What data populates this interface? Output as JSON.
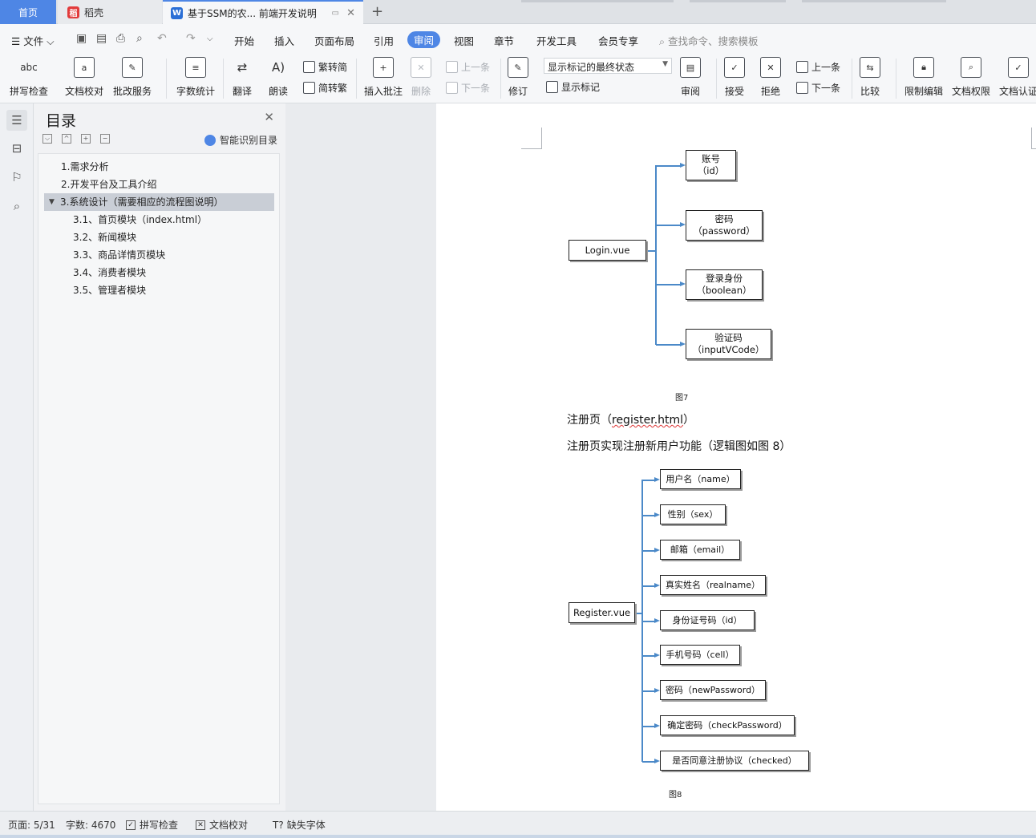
{
  "tabs": {
    "home": "首页",
    "daoke": "稻壳",
    "doc": "基于SSM的农... 前端开发说明",
    "add": "+"
  },
  "menu": {
    "file": "文件",
    "items": [
      "开始",
      "插入",
      "页面布局",
      "引用",
      "审阅",
      "视图",
      "章节",
      "开发工具",
      "会员专享"
    ],
    "active": "审阅",
    "search_placeholder": "查找命令、搜索模板"
  },
  "ribbon": {
    "spell": "拼写检查",
    "proof": "文档校对",
    "correct": "批改服务",
    "wordcount": "字数统计",
    "translate": "翻译",
    "read": "朗读",
    "trad2simp": "繁转简",
    "simp2trad": "简转繁",
    "insert_comment": "插入批注",
    "delete": "删除",
    "prev_comment": "上一条",
    "next_comment": "下一条",
    "track": "修订",
    "markup_state": "显示标记的最终状态",
    "show_markup": "显示标记",
    "review": "审阅",
    "accept": "接受",
    "reject": "拒绝",
    "prev_change": "上一条",
    "next_change": "下一条",
    "compare": "比较",
    "restrict": "限制编辑",
    "permission": "文档权限",
    "certify": "文档认证"
  },
  "toc": {
    "title": "目录",
    "smart": "智能识别目录",
    "items": [
      {
        "text": "1.需求分析",
        "level": 1
      },
      {
        "text": "2.开发平台及工具介绍",
        "level": 1
      },
      {
        "text": "3.系统设计（需要相应的流程图说明）",
        "level": 1,
        "selected": true
      },
      {
        "text": "3.1、首页模块（index.html）",
        "level": 2
      },
      {
        "text": "3.2、新闻模块",
        "level": 2
      },
      {
        "text": "3.3、商品详情页模块",
        "level": 2
      },
      {
        "text": "3.4、消费者模块",
        "level": 2
      },
      {
        "text": "3.5、管理者模块",
        "level": 2
      }
    ]
  },
  "doc": {
    "diagram1": {
      "root": "Login.vue",
      "children": [
        [
          "账号",
          "（id）"
        ],
        [
          "密码",
          "（password）"
        ],
        [
          "登录身份",
          "（boolean）"
        ],
        [
          "验证码",
          "（inputVCode）"
        ]
      ],
      "caption": "图7"
    },
    "para1_prefix": "注册页（",
    "para1_link": "register.html",
    "para1_suffix": "）",
    "para2": "注册页实现注册新用户功能（逻辑图如图 8）",
    "diagram2": {
      "root": "Register.vue",
      "children": [
        "用户名（name）",
        "性别（sex）",
        "邮箱（email）",
        "真实姓名（realname）",
        "身份证号码（id）",
        "手机号码（cell）",
        "密码（newPassword）",
        "确定密码（checkPassword）",
        "是否同意注册协议（checked）"
      ],
      "caption": "图8"
    }
  },
  "status": {
    "page": "页面: 5/31",
    "words": "字数: 4670",
    "spell": "拼写检查",
    "proof": "文档校对",
    "missing_font": "缺失字体"
  }
}
